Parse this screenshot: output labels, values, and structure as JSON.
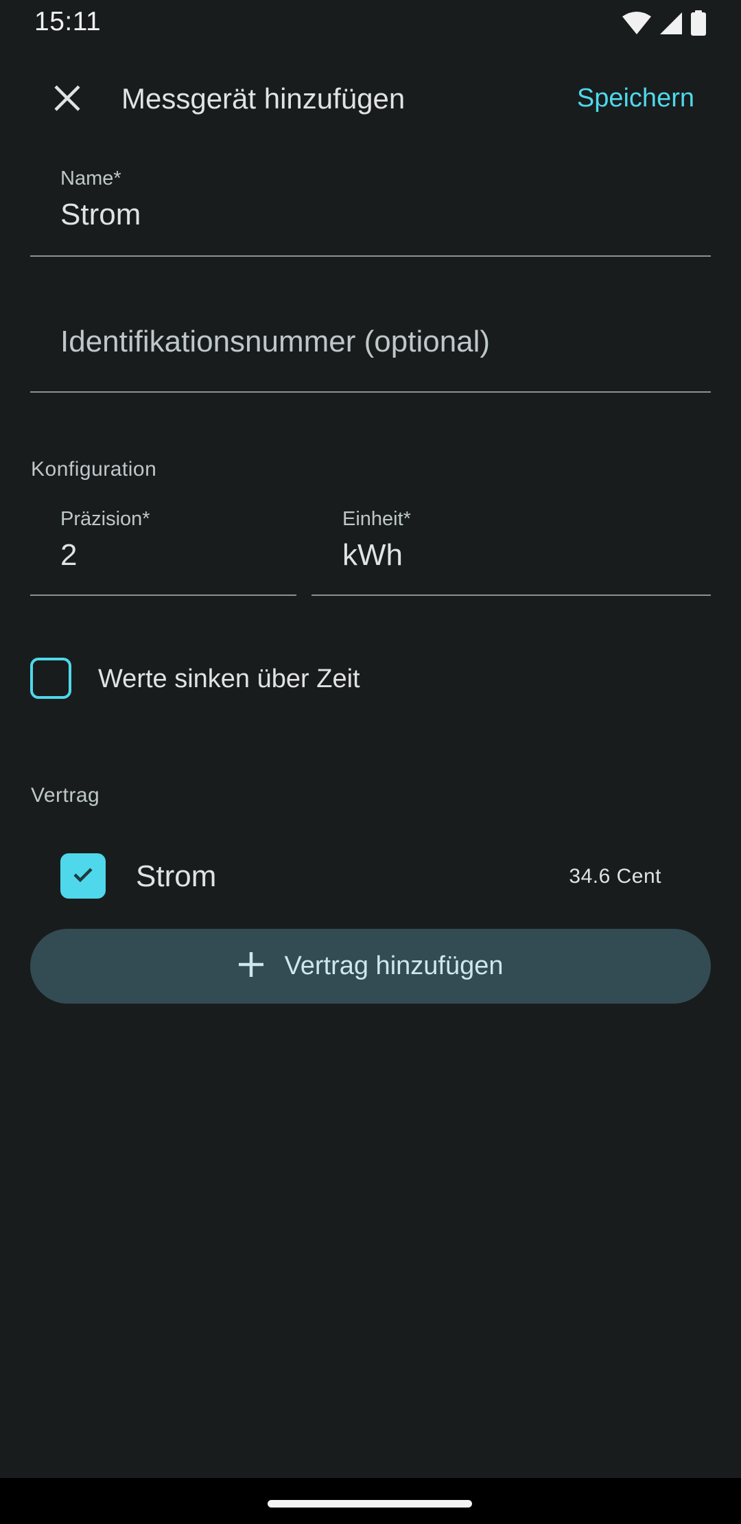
{
  "status_bar": {
    "time": "15:11",
    "icons": [
      "wifi-icon",
      "cell-signal-icon",
      "battery-icon"
    ]
  },
  "app_bar": {
    "close_icon": "close-icon",
    "title": "Messgerät hinzufügen",
    "save_label": "Speichern"
  },
  "form": {
    "name": {
      "label": "Name*",
      "value": "Strom"
    },
    "identification": {
      "placeholder": "Identifikationsnummer (optional)"
    },
    "configuration": {
      "section_label": "Konfiguration",
      "precision": {
        "label": "Präzision*",
        "value": "2"
      },
      "unit": {
        "label": "Einheit*",
        "value": "kWh"
      }
    },
    "values_decrease": {
      "label": "Werte sinken über Zeit",
      "checked": false
    },
    "contract": {
      "section_label": "Vertrag",
      "items": [
        {
          "name": "Strom",
          "price": "34.6 Cent",
          "checked": true
        }
      ],
      "add_button_label": "Vertrag hinzufügen",
      "add_icon": "plus-icon"
    }
  },
  "colors": {
    "background": "#191c1d",
    "accent": "#4fd8eb",
    "button_tonal": "#334b52",
    "text_primary": "#e1e3e3",
    "text_secondary": "#bec8ca",
    "divider": "#8a9296"
  }
}
